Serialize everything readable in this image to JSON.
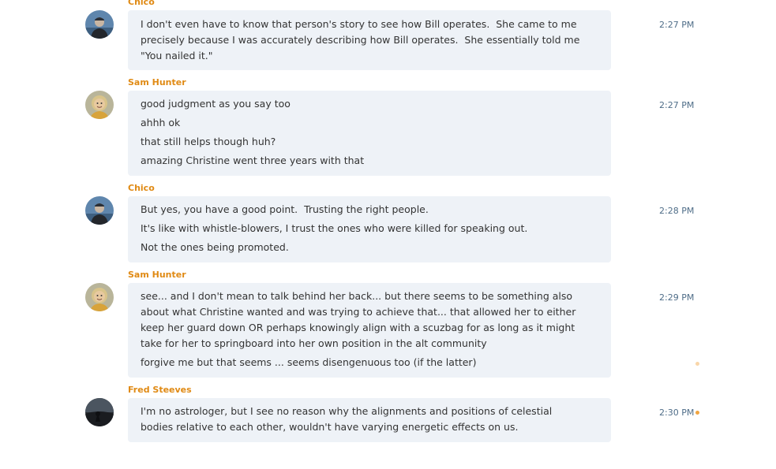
{
  "messages": [
    {
      "author": "Chico",
      "avatar": "chico-avatar",
      "time": "2:27 PM",
      "lines": [
        "I don't even have to know that person's story to see how Bill operates.  She came to me precisely because I was accurately describing how Bill operates.  She essentially told me \"You nailed it.\""
      ]
    },
    {
      "author": "Sam Hunter",
      "avatar": "sam-hunter-avatar",
      "time": "2:27 PM",
      "lines": [
        "good judgment as you say too",
        "ahhh ok",
        "that still helps though huh?",
        "amazing Christine went three years with that"
      ]
    },
    {
      "author": "Chico",
      "avatar": "chico-avatar",
      "time": "2:28 PM",
      "lines": [
        "But yes, you have a good point.  Trusting the right people.",
        "It's like with whistle-blowers, I trust the ones who were killed for speaking out.",
        "Not the ones being promoted."
      ]
    },
    {
      "author": "Sam Hunter",
      "avatar": "sam-hunter-avatar",
      "time": "2:29 PM",
      "lines": [
        "see... and I don't mean to talk behind her back... but there seems to be something also about what Christine wanted and was trying to achieve that... that allowed her to either keep her guard down OR perhaps knowingly align with a scuzbag for as long as it might take for her to springboard into her own position in the alt community",
        "forgive me but that seems ... seems disengenuous too (if the latter)"
      ]
    },
    {
      "author": "Fred Steeves",
      "avatar": "fred-steeves-avatar",
      "time": "2:30 PM",
      "lines": [
        "I'm no astrologer, but I see no reason why the alignments and positions of celestial bodies relative to each other, wouldn't have varying energetic effects on us."
      ]
    }
  ],
  "colors": {
    "author": "#e08a14",
    "bubble": "#eef2f7",
    "time": "#4f6d88",
    "unread_dot": "#f1a541"
  }
}
